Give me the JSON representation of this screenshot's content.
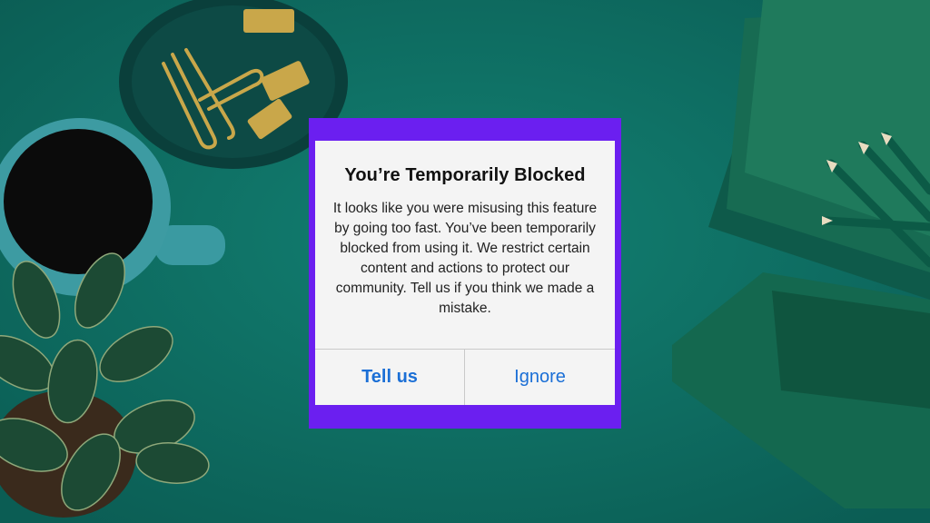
{
  "dialog": {
    "title": "You’re Temporarily Blocked",
    "message": "It looks like you were misusing this feature by going too fast. You’ve been temporarily blocked from using it. We restrict certain content and actions to protect our community. Tell us if you think we made a mistake.",
    "tell_us_label": "Tell us",
    "ignore_label": "Ignore"
  },
  "colors": {
    "background": "#0f6b60",
    "frame": "#6b1ff0",
    "dialog": "#f4f4f4",
    "button_text": "#1b6fd6"
  },
  "decor": {
    "background_items": [
      "coffee-cup-icon",
      "plant-icon",
      "paper-clips-icon",
      "tray-icon",
      "notebooks-icon",
      "pencils-icon"
    ]
  }
}
